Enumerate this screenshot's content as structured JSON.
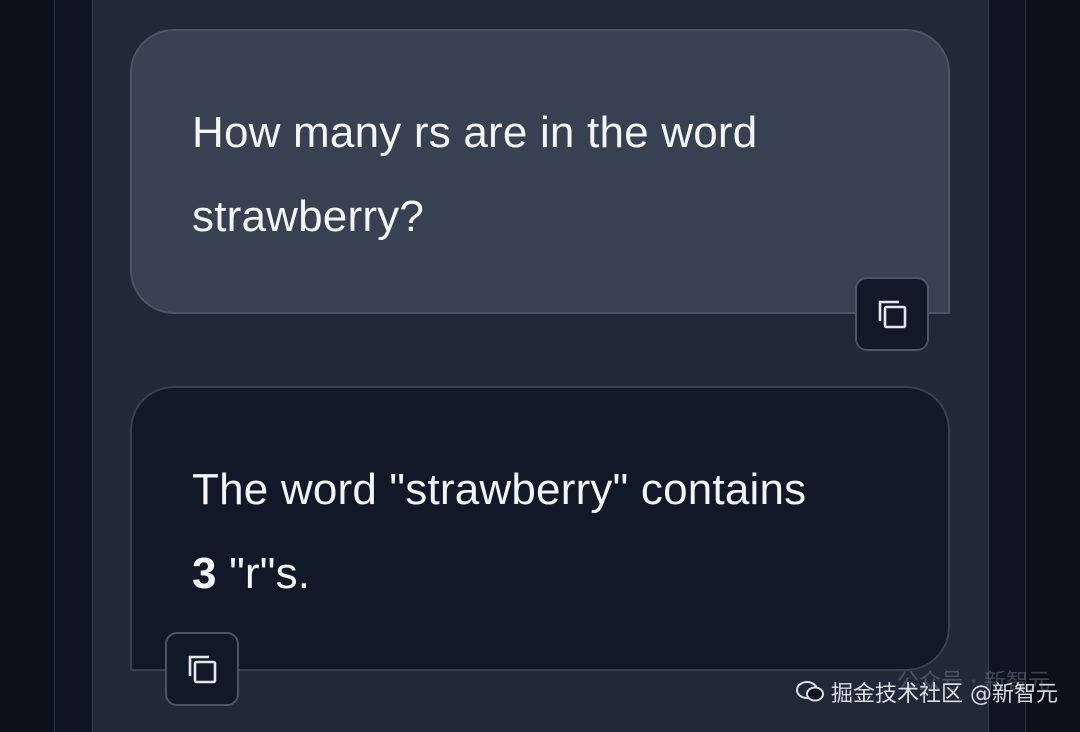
{
  "messages": {
    "user": {
      "line1": "How many rs are in the word",
      "line2": "strawberry?"
    },
    "bot": {
      "line1": "The word \"strawberry\" contains",
      "bold_value": "3",
      "line2_rest": " \"r\"s."
    }
  },
  "buttons": {
    "copy_icon": "copy-icon"
  },
  "watermark": {
    "main": "掘金技术社区 @新智元",
    "ghost": "公众号 · 新智元"
  },
  "colors": {
    "page_bg": "#0b0f19",
    "panel_bg": "#1f2937",
    "user_bubble": "#374151",
    "bot_bubble": "#111827",
    "text": "#f3f4f6"
  }
}
